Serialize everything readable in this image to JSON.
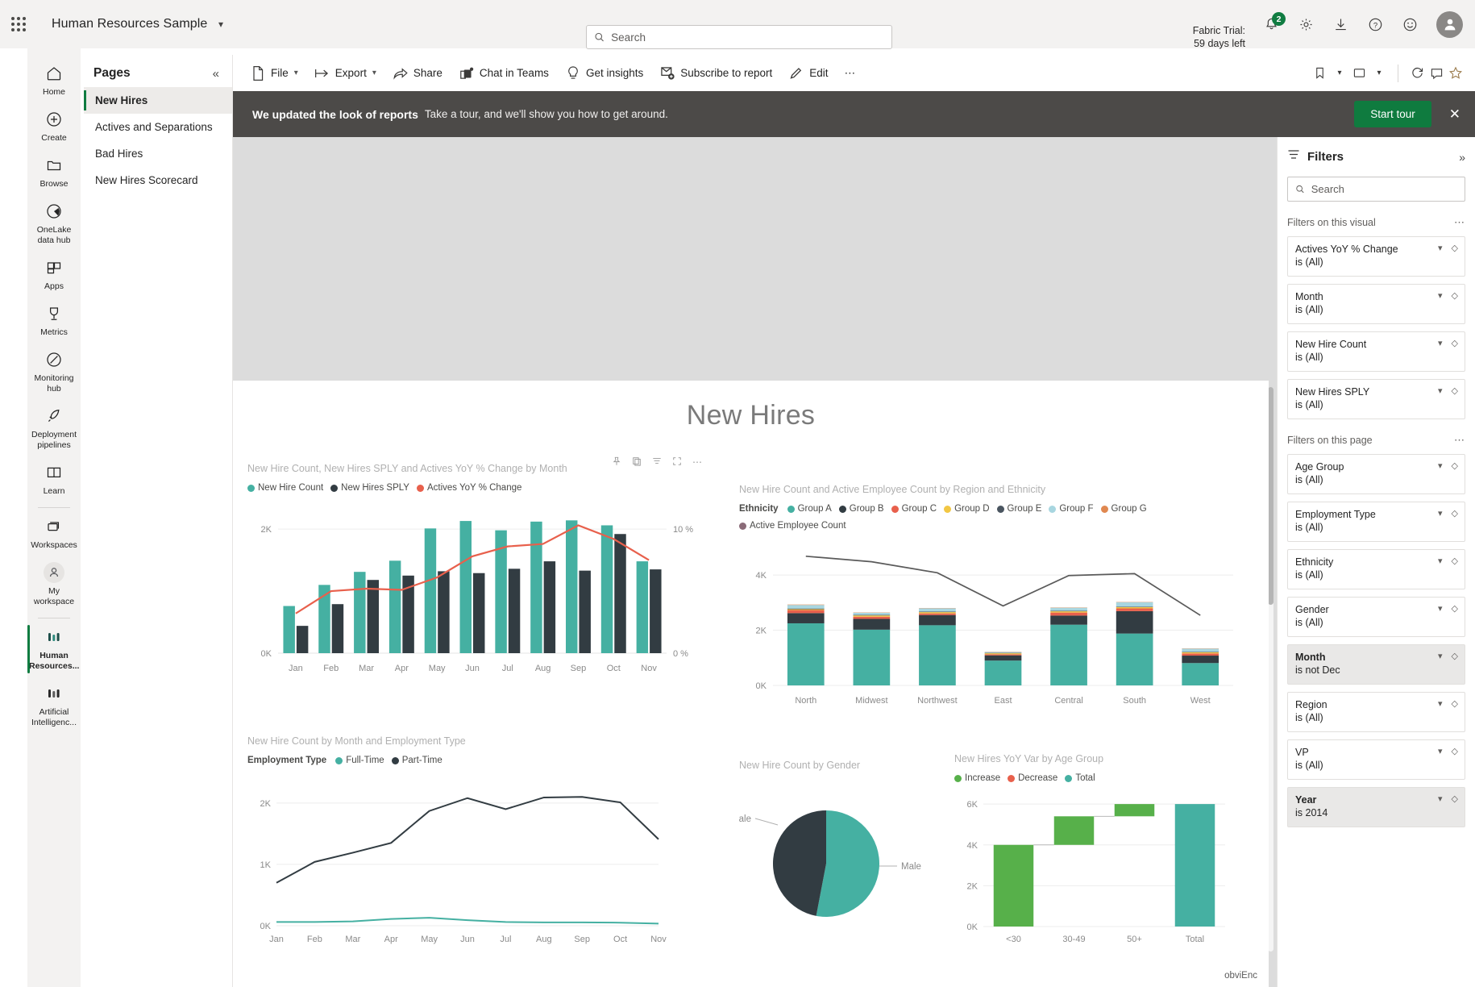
{
  "topbar": {
    "app_title": "Human Resources Sample",
    "search_placeholder": "Search",
    "search_value": "",
    "trial_line1": "Fabric Trial:",
    "trial_line2": "59 days left",
    "notification_count": "2",
    "icons": [
      "waffle-icon",
      "search-icon",
      "notification-bell-icon",
      "gear-icon",
      "download-icon",
      "help-icon",
      "feedback-smiley-icon",
      "account-avatar"
    ]
  },
  "rail": {
    "items": [
      {
        "label": "Home",
        "icon": "home-icon",
        "active": false
      },
      {
        "label": "Create",
        "icon": "plus-circle-icon",
        "active": false
      },
      {
        "label": "Browse",
        "icon": "folder-icon",
        "active": false
      },
      {
        "label": "OneLake\ndata hub",
        "icon": "onelake-icon",
        "active": false
      },
      {
        "label": "Apps",
        "icon": "apps-grid-icon",
        "active": false
      },
      {
        "label": "Metrics",
        "icon": "trophy-icon",
        "active": false
      },
      {
        "label": "Monitoring\nhub",
        "icon": "compass-icon",
        "active": false
      },
      {
        "label": "Deployment\npipelines",
        "icon": "rocket-icon",
        "active": false
      },
      {
        "label": "Learn",
        "icon": "book-icon",
        "active": false
      },
      {
        "label": "Workspaces",
        "icon": "workspaces-icon",
        "active": false
      },
      {
        "label": "My\nworkspace",
        "icon": "person-icon",
        "active": false
      },
      {
        "label": "Human\nResources...",
        "icon": "report-bars-icon",
        "active": true
      },
      {
        "label": "Artificial\nIntelligenc...",
        "icon": "report-bars-icon",
        "active": false
      }
    ]
  },
  "pages_pane": {
    "title": "Pages",
    "collapse_icon": "chevron-double-left-icon",
    "items": [
      {
        "label": "New Hires",
        "active": true
      },
      {
        "label": "Actives and Separations",
        "active": false
      },
      {
        "label": "Bad Hires",
        "active": false
      },
      {
        "label": "New Hires Scorecard",
        "active": false
      }
    ]
  },
  "toolbar": {
    "buttons": [
      {
        "label": "File",
        "icon": "file-icon",
        "chevron": true
      },
      {
        "label": "Export",
        "icon": "export-icon",
        "chevron": true
      },
      {
        "label": "Share",
        "icon": "share-icon",
        "chevron": false
      },
      {
        "label": "Chat in Teams",
        "icon": "teams-icon",
        "chevron": false
      },
      {
        "label": "Get insights",
        "icon": "lightbulb-icon",
        "chevron": false
      },
      {
        "label": "Subscribe to report",
        "icon": "subscribe-icon",
        "chevron": false
      },
      {
        "label": "Edit",
        "icon": "pencil-icon",
        "chevron": false
      },
      {
        "label": "⋯",
        "icon": "more-icon",
        "chevron": false
      }
    ],
    "right_icons": [
      "bookmark-icon",
      "chevron-down-icon",
      "view-icon",
      "chevron-down-icon",
      "refresh-icon",
      "comment-icon",
      "favorite-star-icon"
    ]
  },
  "banner": {
    "headline": "We updated the look of reports",
    "text": "Take a tour, and we'll show you how to get around.",
    "button_label": "Start tour",
    "close_icon": "close-icon"
  },
  "report": {
    "title": "New Hires",
    "watermark": "obviEnc"
  },
  "filters": {
    "title": "Filters",
    "filter_icon": "filter-icon",
    "expand_icon": "chevron-double-right-icon",
    "search_placeholder": "Search",
    "search_value": "",
    "visual_section": "Filters on this visual",
    "page_section": "Filters on this page",
    "more_icon": "ellipsis-icon",
    "visual_filters": [
      {
        "field": "Actives YoY % Change",
        "value": "is (All)",
        "highlight": false
      },
      {
        "field": "Month",
        "value": "is (All)",
        "highlight": false
      },
      {
        "field": "New Hire Count",
        "value": "is (All)",
        "highlight": false
      },
      {
        "field": "New Hires SPLY",
        "value": "is (All)",
        "highlight": false
      }
    ],
    "page_filters": [
      {
        "field": "Age Group",
        "value": "is (All)",
        "highlight": false
      },
      {
        "field": "Employment Type",
        "value": "is (All)",
        "highlight": false
      },
      {
        "field": "Ethnicity",
        "value": "is (All)",
        "highlight": false
      },
      {
        "field": "Gender",
        "value": "is (All)",
        "highlight": false
      },
      {
        "field": "Month",
        "value": "is not Dec",
        "highlight": true
      },
      {
        "field": "Region",
        "value": "is (All)",
        "highlight": false
      },
      {
        "field": "VP",
        "value": "is (All)",
        "highlight": false
      },
      {
        "field": "Year",
        "value": "is 2014",
        "highlight": true
      }
    ]
  },
  "visual_toolbar_icons": [
    "pin-icon",
    "copy-icon",
    "filter-icon",
    "focus-icon",
    "more-options-icon"
  ],
  "colors": {
    "teal": "#45b0a2",
    "dark": "#323c42",
    "red": "#e8604c",
    "yellow": "#f2c744",
    "slate": "#4a5560",
    "lightblue": "#a8d6e0",
    "orange": "#e08850",
    "purple": "#8a6b78",
    "green": "#57b04a",
    "accent_green": "#107c41",
    "banner_bg": "#4c4a48",
    "gray_line": "#5a5a5a"
  },
  "chart_data": [
    {
      "id": "new-hire-count-sply-actives-by-month",
      "type": "bar",
      "title": "New Hire Count, New Hires SPLY and Actives YoY % Change by Month",
      "categories": [
        "Jan",
        "Feb",
        "Mar",
        "Apr",
        "May",
        "Jun",
        "Jul",
        "Aug",
        "Sep",
        "Oct",
        "Nov"
      ],
      "series": [
        {
          "name": "New Hire Count",
          "type": "column",
          "color": "#45b0a2",
          "values": [
            760,
            1100,
            1310,
            1490,
            2010,
            2130,
            1980,
            2120,
            2140,
            2060,
            1480
          ]
        },
        {
          "name": "New Hires SPLY",
          "type": "column",
          "color": "#323c42",
          "values": [
            440,
            790,
            1180,
            1250,
            1320,
            1290,
            1360,
            1480,
            1330,
            1920,
            1350
          ]
        },
        {
          "name": "Actives YoY % Change",
          "type": "line",
          "color": "#e8604c",
          "values": [
            3.2,
            5.0,
            5.2,
            5.1,
            6.1,
            7.8,
            8.6,
            8.8,
            10.3,
            9.2,
            7.5
          ]
        }
      ],
      "ylabel": "",
      "xlabel": "",
      "ylim": [
        0,
        2300
      ],
      "y_ticks": [
        "0K",
        "2K"
      ],
      "y2_ticks": [
        "0 %",
        "10 %"
      ],
      "y2lim": [
        0,
        11.5
      ],
      "grid": true,
      "legend": "top"
    },
    {
      "id": "new-hire-count-active-employee-by-region-ethnicity",
      "type": "bar",
      "title": "New Hire Count and Active Employee Count by Region and Ethnicity",
      "legend_label": "Ethnicity",
      "categories": [
        "North",
        "Midwest",
        "Northwest",
        "East",
        "Central",
        "South",
        "West"
      ],
      "series": [
        {
          "name": "Group A",
          "color": "#45b0a2",
          "values": [
            2250,
            2020,
            2180,
            900,
            2200,
            1880,
            810
          ]
        },
        {
          "name": "Group B",
          "color": "#323c42",
          "values": [
            370,
            390,
            370,
            190,
            330,
            810,
            270
          ]
        },
        {
          "name": "Group C",
          "color": "#e8604c",
          "values": [
            110,
            80,
            60,
            40,
            110,
            100,
            80
          ]
        },
        {
          "name": "Group D",
          "color": "#f2c744",
          "values": [
            30,
            45,
            45,
            35,
            45,
            45,
            40
          ]
        },
        {
          "name": "Group E",
          "color": "#4a5560",
          "values": [
            25,
            20,
            20,
            15,
            20,
            20,
            20
          ]
        },
        {
          "name": "Group F",
          "color": "#a8d6e0",
          "values": [
            130,
            80,
            120,
            30,
            110,
            160,
            110
          ]
        },
        {
          "name": "Group G",
          "color": "#e08850",
          "values": [
            15,
            10,
            10,
            8,
            10,
            10,
            10
          ]
        },
        {
          "name": "Active Employee Count",
          "type": "line",
          "color": "#5a5a5a",
          "values": [
            4680,
            4480,
            4080,
            2880,
            3980,
            4050,
            2540
          ]
        }
      ],
      "ylim": [
        0,
        5200
      ],
      "y_ticks": [
        "0K",
        "2K",
        "4K"
      ],
      "grid": true,
      "legend": "top"
    },
    {
      "id": "new-hire-count-by-month-employment-type",
      "type": "line",
      "title": "New Hire Count by Month and Employment Type",
      "legend_label": "Employment Type",
      "categories": [
        "Jan",
        "Feb",
        "Mar",
        "Apr",
        "May",
        "Jun",
        "Jul",
        "Aug",
        "Sep",
        "Oct",
        "Nov"
      ],
      "series": [
        {
          "name": "Full-Time",
          "color": "#45b0a2",
          "values": [
            60,
            60,
            70,
            110,
            130,
            90,
            60,
            55,
            55,
            50,
            35
          ]
        },
        {
          "name": "Part-Time",
          "color": "#323c42",
          "values": [
            700,
            1040,
            1190,
            1350,
            1870,
            2080,
            1900,
            2090,
            2100,
            2010,
            1410
          ]
        }
      ],
      "ylim": [
        0,
        2300
      ],
      "y_ticks": [
        "0K",
        "1K",
        "2K"
      ],
      "grid": true,
      "legend": "top"
    },
    {
      "id": "new-hire-count-by-gender",
      "type": "pie",
      "title": "New Hire Count by Gender",
      "labels": [
        "Male",
        "Female"
      ],
      "values": [
        53,
        47
      ],
      "colors": [
        "#45b0a2",
        "#323c42"
      ]
    },
    {
      "id": "new-hires-yoy-var-by-age-group",
      "type": "bar",
      "title": "New Hires YoY Var by Age Group",
      "legend_entries": [
        {
          "name": "Increase",
          "color": "#57b04a"
        },
        {
          "name": "Decrease",
          "color": "#e8604c"
        },
        {
          "name": "Total",
          "color": "#45b0a2"
        }
      ],
      "categories": [
        "<30",
        "30-49",
        "50+",
        "Total"
      ],
      "values": [
        4000,
        1400,
        600,
        6000
      ],
      "bar_kinds": [
        "increase",
        "increase",
        "increase",
        "total"
      ],
      "cumulative_start": [
        0,
        4000,
        5400,
        0
      ],
      "ylim": [
        0,
        6400
      ],
      "y_ticks": [
        "0K",
        "2K",
        "4K",
        "6K"
      ],
      "grid": true
    }
  ]
}
